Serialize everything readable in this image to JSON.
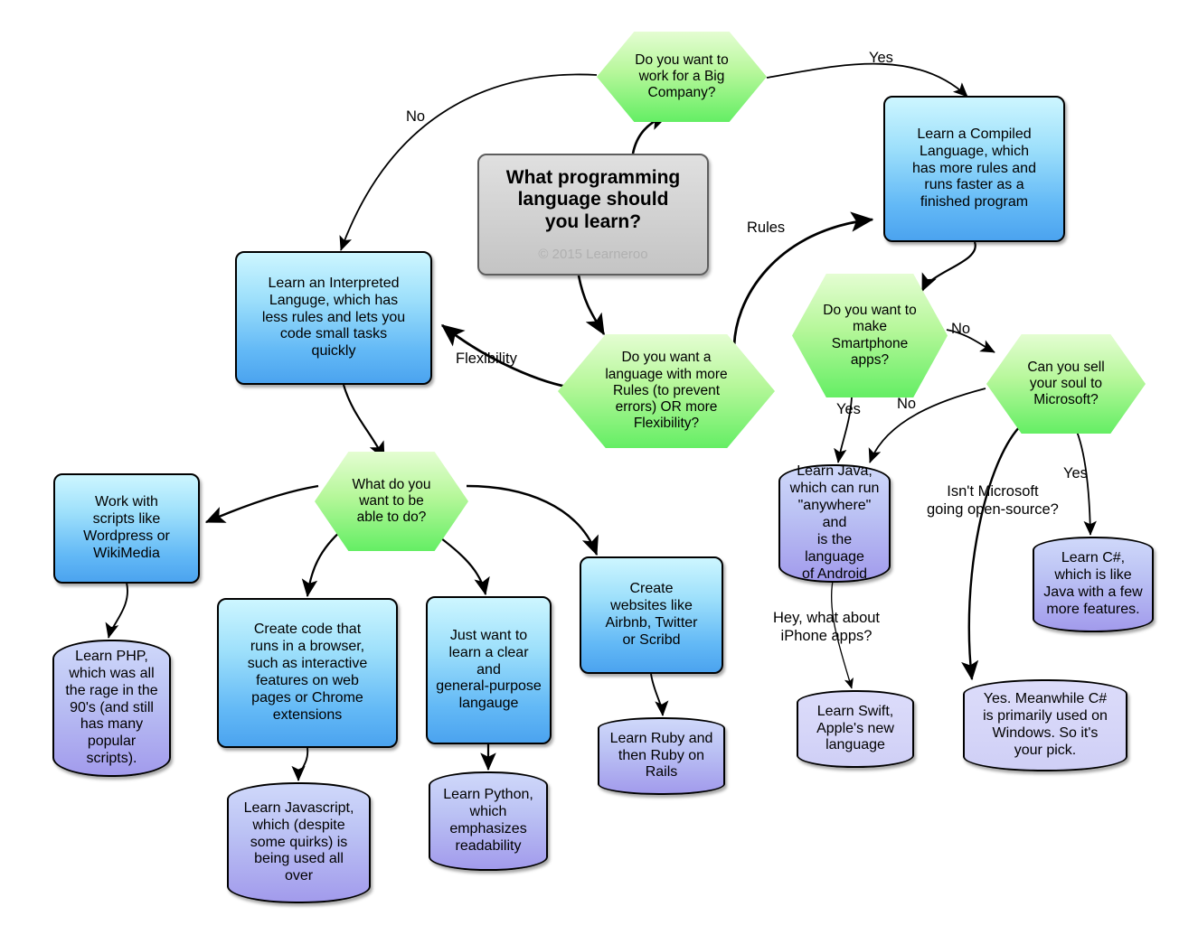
{
  "title": "What programming language should you learn? flowchart",
  "colors": {
    "start_fill": "#cfcfcf",
    "decision_fill_top": "#e4fdd2",
    "decision_fill_bottom": "#64ee64",
    "action_fill_top": "#cdf6ff",
    "action_fill_bottom": "#4ba3ef",
    "result_fill_top": "#cfd8fa",
    "result_fill_bottom": "#a29bec",
    "result_light_fill": "#d6d6f8",
    "stroke": "#000000",
    "copyright_text": "#b0b0b0"
  },
  "nodes": {
    "start": {
      "label": "What programming\nlanguage should\nyou learn?",
      "copyright": "© 2015 Learneroo"
    },
    "q_big_company": {
      "label": "Do you want to\nwork for a Big\nCompany?"
    },
    "q_rules_flex": {
      "label": "Do you want a\nlanguage with more\nRules (to prevent\nerrors) OR more\nFlexibility?"
    },
    "compiled": {
      "label": "Learn a Compiled\nLanguage, which\nhas more rules and\nruns faster as a\nfinished program"
    },
    "interpreted": {
      "label": "Learn an Interpreted\nLanguge, which has\nless rules and lets you\ncode small tasks\nquickly"
    },
    "q_smartphone": {
      "label": "Do you want to\nmake\nSmartphone\napps?"
    },
    "q_microsoft": {
      "label": "Can you sell\nyour soul to\nMicrosoft?"
    },
    "java": {
      "label": "Learn Java,\nwhich can run\n\"anywhere\" and\nis the language\nof Android"
    },
    "csharp": {
      "label": "Learn C#,\nwhich is like\nJava with a few\nmore features."
    },
    "swift": {
      "label": "Learn Swift,\nApple's new\nlanguage"
    },
    "ms_answer": {
      "label": "Yes. Meanwhile C#\nis primarily used on\nWindows. So it's\nyour pick."
    },
    "q_what_do": {
      "label": "What do you\nwant to be\nable to do?"
    },
    "scripts": {
      "label": "Work with\nscripts like\nWordpress or\nWikiMedia"
    },
    "browser_code": {
      "label": "Create code that\nruns in a browser,\nsuch as interactive\nfeatures on web\npages or Chrome\nextensions"
    },
    "general_purpose": {
      "label": "Just want to\nlearn a clear\nand\ngeneral-purpose\nlangauge"
    },
    "websites": {
      "label": "Create\nwebsites like\nAirbnb, Twitter\nor Scribd"
    },
    "php": {
      "label": "Learn PHP,\nwhich was all\nthe rage in the\n90's (and still\nhas many\npopular scripts)."
    },
    "javascript": {
      "label": "Learn Javascript,\nwhich (despite\nsome quirks) is\nbeing used all\nover"
    },
    "python": {
      "label": "Learn Python,\nwhich\nemphasizes\nreadability"
    },
    "ruby": {
      "label": "Learn Ruby and\nthen Ruby on\nRails"
    }
  },
  "edge_labels": {
    "no_big_company": "No",
    "yes_big_company": "Yes",
    "rules": "Rules",
    "flexibility": "Flexibility",
    "smartphone_no": "No",
    "smartphone_yes": "Yes",
    "microsoft_no": "No",
    "microsoft_yes": "Yes",
    "iphone_question": "Hey, what about\niPhone apps?",
    "opensource_question": "Isn't Microsoft\ngoing open-source?"
  }
}
